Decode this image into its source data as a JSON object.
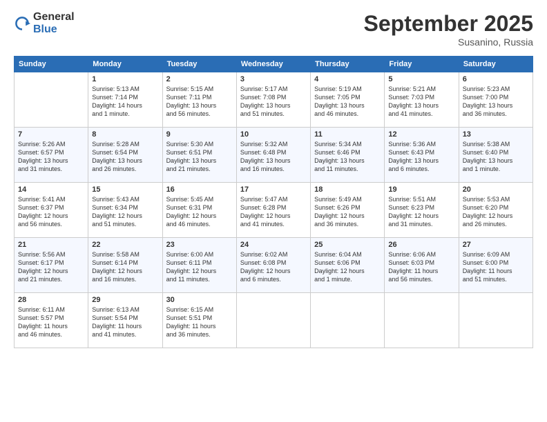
{
  "logo": {
    "general": "General",
    "blue": "Blue"
  },
  "title": "September 2025",
  "location": "Susanino, Russia",
  "weekdays": [
    "Sunday",
    "Monday",
    "Tuesday",
    "Wednesday",
    "Thursday",
    "Friday",
    "Saturday"
  ],
  "weeks": [
    [
      {
        "day": "",
        "text": ""
      },
      {
        "day": "1",
        "text": "Sunrise: 5:13 AM\nSunset: 7:14 PM\nDaylight: 14 hours\nand 1 minute."
      },
      {
        "day": "2",
        "text": "Sunrise: 5:15 AM\nSunset: 7:11 PM\nDaylight: 13 hours\nand 56 minutes."
      },
      {
        "day": "3",
        "text": "Sunrise: 5:17 AM\nSunset: 7:08 PM\nDaylight: 13 hours\nand 51 minutes."
      },
      {
        "day": "4",
        "text": "Sunrise: 5:19 AM\nSunset: 7:05 PM\nDaylight: 13 hours\nand 46 minutes."
      },
      {
        "day": "5",
        "text": "Sunrise: 5:21 AM\nSunset: 7:03 PM\nDaylight: 13 hours\nand 41 minutes."
      },
      {
        "day": "6",
        "text": "Sunrise: 5:23 AM\nSunset: 7:00 PM\nDaylight: 13 hours\nand 36 minutes."
      }
    ],
    [
      {
        "day": "7",
        "text": "Sunrise: 5:26 AM\nSunset: 6:57 PM\nDaylight: 13 hours\nand 31 minutes."
      },
      {
        "day": "8",
        "text": "Sunrise: 5:28 AM\nSunset: 6:54 PM\nDaylight: 13 hours\nand 26 minutes."
      },
      {
        "day": "9",
        "text": "Sunrise: 5:30 AM\nSunset: 6:51 PM\nDaylight: 13 hours\nand 21 minutes."
      },
      {
        "day": "10",
        "text": "Sunrise: 5:32 AM\nSunset: 6:48 PM\nDaylight: 13 hours\nand 16 minutes."
      },
      {
        "day": "11",
        "text": "Sunrise: 5:34 AM\nSunset: 6:46 PM\nDaylight: 13 hours\nand 11 minutes."
      },
      {
        "day": "12",
        "text": "Sunrise: 5:36 AM\nSunset: 6:43 PM\nDaylight: 13 hours\nand 6 minutes."
      },
      {
        "day": "13",
        "text": "Sunrise: 5:38 AM\nSunset: 6:40 PM\nDaylight: 13 hours\nand 1 minute."
      }
    ],
    [
      {
        "day": "14",
        "text": "Sunrise: 5:41 AM\nSunset: 6:37 PM\nDaylight: 12 hours\nand 56 minutes."
      },
      {
        "day": "15",
        "text": "Sunrise: 5:43 AM\nSunset: 6:34 PM\nDaylight: 12 hours\nand 51 minutes."
      },
      {
        "day": "16",
        "text": "Sunrise: 5:45 AM\nSunset: 6:31 PM\nDaylight: 12 hours\nand 46 minutes."
      },
      {
        "day": "17",
        "text": "Sunrise: 5:47 AM\nSunset: 6:28 PM\nDaylight: 12 hours\nand 41 minutes."
      },
      {
        "day": "18",
        "text": "Sunrise: 5:49 AM\nSunset: 6:26 PM\nDaylight: 12 hours\nand 36 minutes."
      },
      {
        "day": "19",
        "text": "Sunrise: 5:51 AM\nSunset: 6:23 PM\nDaylight: 12 hours\nand 31 minutes."
      },
      {
        "day": "20",
        "text": "Sunrise: 5:53 AM\nSunset: 6:20 PM\nDaylight: 12 hours\nand 26 minutes."
      }
    ],
    [
      {
        "day": "21",
        "text": "Sunrise: 5:56 AM\nSunset: 6:17 PM\nDaylight: 12 hours\nand 21 minutes."
      },
      {
        "day": "22",
        "text": "Sunrise: 5:58 AM\nSunset: 6:14 PM\nDaylight: 12 hours\nand 16 minutes."
      },
      {
        "day": "23",
        "text": "Sunrise: 6:00 AM\nSunset: 6:11 PM\nDaylight: 12 hours\nand 11 minutes."
      },
      {
        "day": "24",
        "text": "Sunrise: 6:02 AM\nSunset: 6:08 PM\nDaylight: 12 hours\nand 6 minutes."
      },
      {
        "day": "25",
        "text": "Sunrise: 6:04 AM\nSunset: 6:06 PM\nDaylight: 12 hours\nand 1 minute."
      },
      {
        "day": "26",
        "text": "Sunrise: 6:06 AM\nSunset: 6:03 PM\nDaylight: 11 hours\nand 56 minutes."
      },
      {
        "day": "27",
        "text": "Sunrise: 6:09 AM\nSunset: 6:00 PM\nDaylight: 11 hours\nand 51 minutes."
      }
    ],
    [
      {
        "day": "28",
        "text": "Sunrise: 6:11 AM\nSunset: 5:57 PM\nDaylight: 11 hours\nand 46 minutes."
      },
      {
        "day": "29",
        "text": "Sunrise: 6:13 AM\nSunset: 5:54 PM\nDaylight: 11 hours\nand 41 minutes."
      },
      {
        "day": "30",
        "text": "Sunrise: 6:15 AM\nSunset: 5:51 PM\nDaylight: 11 hours\nand 36 minutes."
      },
      {
        "day": "",
        "text": ""
      },
      {
        "day": "",
        "text": ""
      },
      {
        "day": "",
        "text": ""
      },
      {
        "day": "",
        "text": ""
      }
    ]
  ]
}
